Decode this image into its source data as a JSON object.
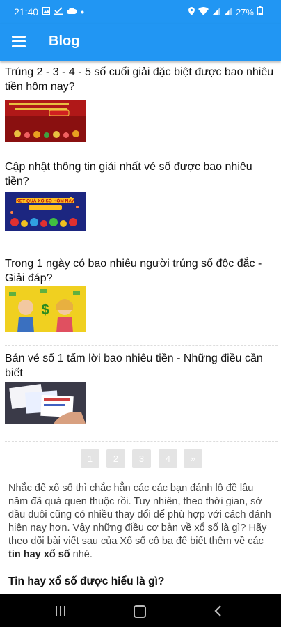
{
  "status": {
    "time": "21:40",
    "battery": "27%"
  },
  "app_bar": {
    "title": "Blog"
  },
  "posts": [
    {
      "title": "Trúng 2 - 3 - 4 - 5 số cuối giải đặc biệt được bao nhiêu tiền hôm nay?"
    },
    {
      "title": "Cập nhật thông tin giải nhất vé số được bao nhiêu tiền?",
      "thumb_text": "KẾT QUẢ XỔ SỐ HÔM NAY"
    },
    {
      "title": "Trong 1 ngày có bao nhiêu người trúng số độc đắc - Giải đáp?"
    },
    {
      "title": "Bán vé số 1 tấm lời bao nhiêu tiền - Những điều cần biết"
    }
  ],
  "pagination": [
    "1",
    "2",
    "3",
    "4",
    "»"
  ],
  "intro": {
    "text": "Nhắc đế xổ số thì chắc hẳn các các bạn đánh lô đề lâu năm đã quá quen thuộc rồi. Tuy nhiên, theo thời gian, sớ đầu đuôi cũng có nhiều thay đổi để phù hợp với cách đánh hiện nay hơn. Vậy những điều cơ bản về xổ số là gì? Hãy theo dõi bài viết sau của Xổ số cô ba để biết thêm về các ",
    "bold": "tin hay xổ số",
    "tail": " nhé."
  },
  "subheading": "Tin hay xổ số được hiểu là gì?",
  "colors": {
    "primary": "#2196f3",
    "nav_bar": "#000000",
    "page_button": "#e4e4e4"
  }
}
